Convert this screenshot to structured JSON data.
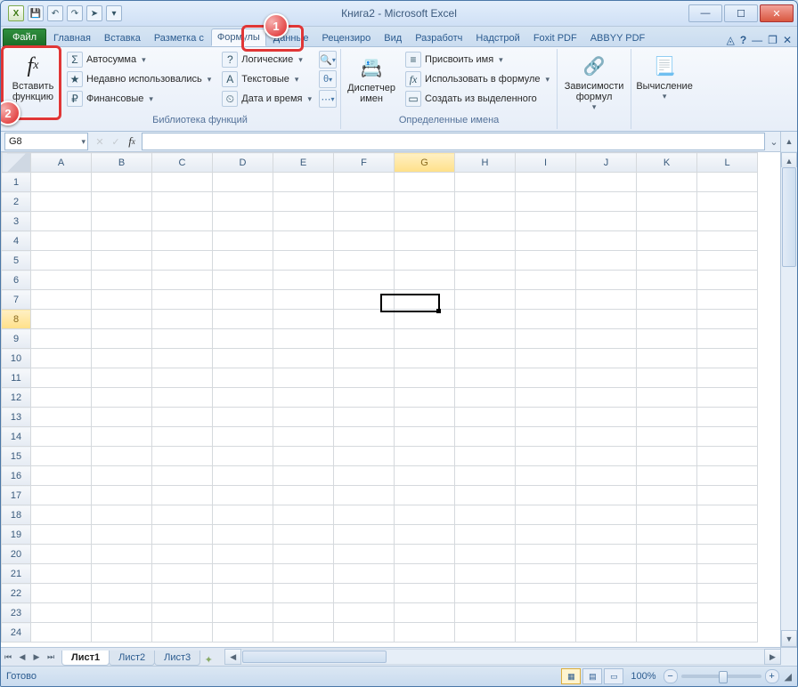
{
  "window": {
    "title": "Книга2 - Microsoft Excel"
  },
  "qat_icons": [
    "xls",
    "save",
    "undo",
    "redo",
    "fwd",
    "customize"
  ],
  "tabs": {
    "file": "Файл",
    "items": [
      "Главная",
      "Вставка",
      "Разметка с",
      "Формулы",
      "Данные",
      "Рецензиро",
      "Вид",
      "Разработч",
      "Надстрой",
      "Foxit PDF",
      "ABBYY PDF"
    ],
    "active_index": 3
  },
  "badges": {
    "1": "1",
    "2": "2"
  },
  "ribbon": {
    "insert_fn": {
      "label": "Вставить\nфункцию",
      "icon": "fx"
    },
    "library": {
      "label": "Библиотека функций",
      "col1": [
        {
          "icon": "Σ",
          "label": "Автосумма",
          "dd": true
        },
        {
          "icon": "★",
          "label": "Недавно использовались",
          "dd": true
        },
        {
          "icon": "₽",
          "label": "Финансовые",
          "dd": true
        }
      ],
      "col2": [
        {
          "icon": "?",
          "label": "Логические",
          "dd": true
        },
        {
          "icon": "A",
          "label": "Текстовые",
          "dd": true
        },
        {
          "icon": "⏲",
          "label": "Дата и время",
          "dd": true
        }
      ],
      "icon_col": [
        "🔍",
        "θ",
        "⋯"
      ]
    },
    "names": {
      "label": "Определенные имена",
      "big": {
        "icon": "📇",
        "label": "Диспетчер\nимен"
      },
      "rows": [
        {
          "icon": "≡",
          "label": "Присвоить имя",
          "dd": true
        },
        {
          "icon": "fx",
          "label": "Использовать в формуле",
          "dd": true
        },
        {
          "icon": "▭",
          "label": "Создать из выделенного"
        }
      ]
    },
    "audit": {
      "label": "",
      "big": {
        "icon": "🔗",
        "label": "Зависимости\nформул"
      }
    },
    "calc": {
      "label": "",
      "big": {
        "icon": "📃",
        "label": "Вычисление"
      }
    }
  },
  "namebox": "G8",
  "grid": {
    "columns": [
      "A",
      "B",
      "C",
      "D",
      "E",
      "F",
      "G",
      "H",
      "I",
      "J",
      "K",
      "L"
    ],
    "rows": 24,
    "selected_col": "G",
    "selected_row": 8
  },
  "sheets": {
    "items": [
      "Лист1",
      "Лист2",
      "Лист3"
    ],
    "active": 0
  },
  "status": {
    "ready": "Готово",
    "zoom": "100%"
  }
}
